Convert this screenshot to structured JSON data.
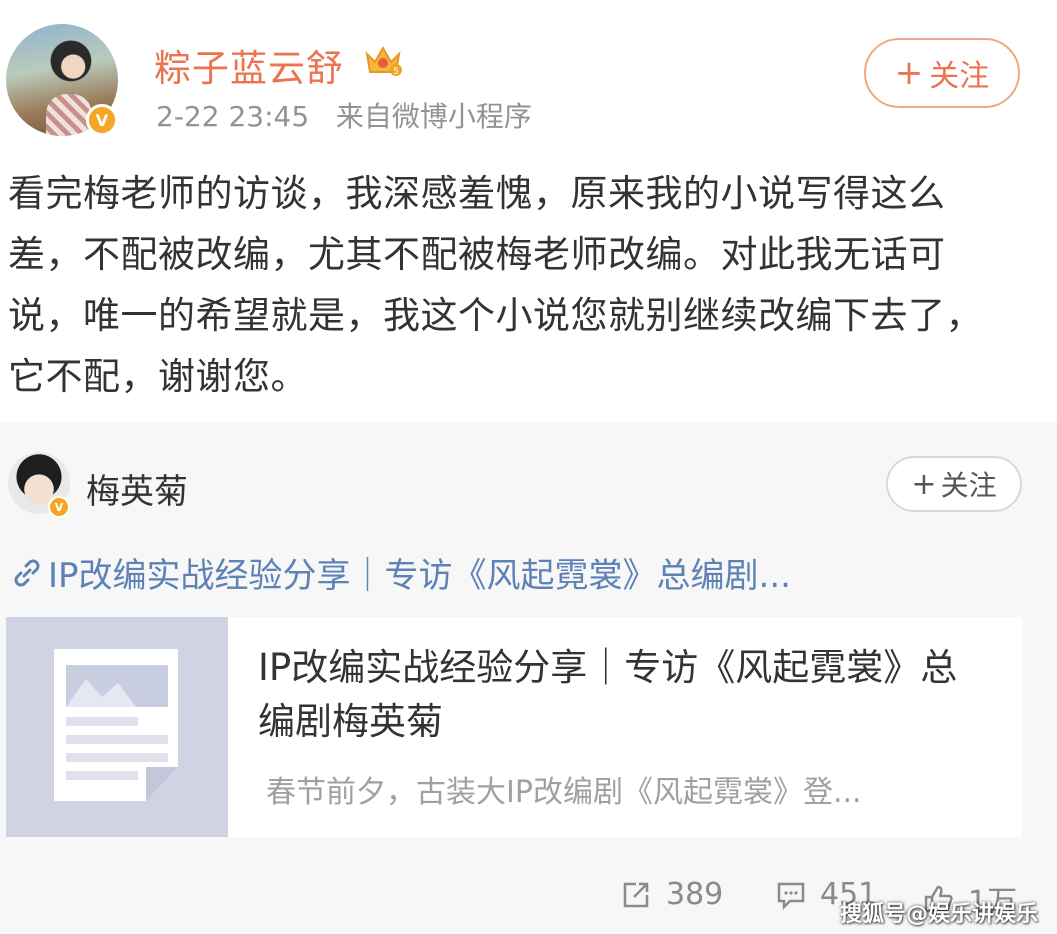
{
  "post": {
    "username": "粽子蓝云舒",
    "timestamp": "2-22 23:45",
    "source": "来自微博小程序",
    "follow_label": "关注",
    "text": "看完梅老师的访谈，我深感羞愧，原来我的小说写得这么差，不配被改编，尤其不配被梅老师改编。对此我无话可说，唯一的希望就是，我这个小说您就别继续改编下去了，它不配，谢谢您。",
    "verified_mark": "V"
  },
  "repost": {
    "author": "梅英菊",
    "follow_label": "关注",
    "verified_mark": "V",
    "link_text": "IP改编实战经验分享｜专访《风起霓裳》总编剧...",
    "article": {
      "title": "IP改编实战经验分享｜专访《风起霓裳》总编剧梅英菊",
      "description": "春节前夕，古装大IP改编剧《风起霓裳》登..."
    }
  },
  "stats": {
    "repost_count": "389",
    "comment_count": "451",
    "like_count": "1万"
  },
  "watermark": "搜狐号@娱乐讲娱乐",
  "colors": {
    "username": "#eb7350",
    "link": "#5d82b6",
    "meta": "#939393",
    "verified": "#f5a623"
  }
}
